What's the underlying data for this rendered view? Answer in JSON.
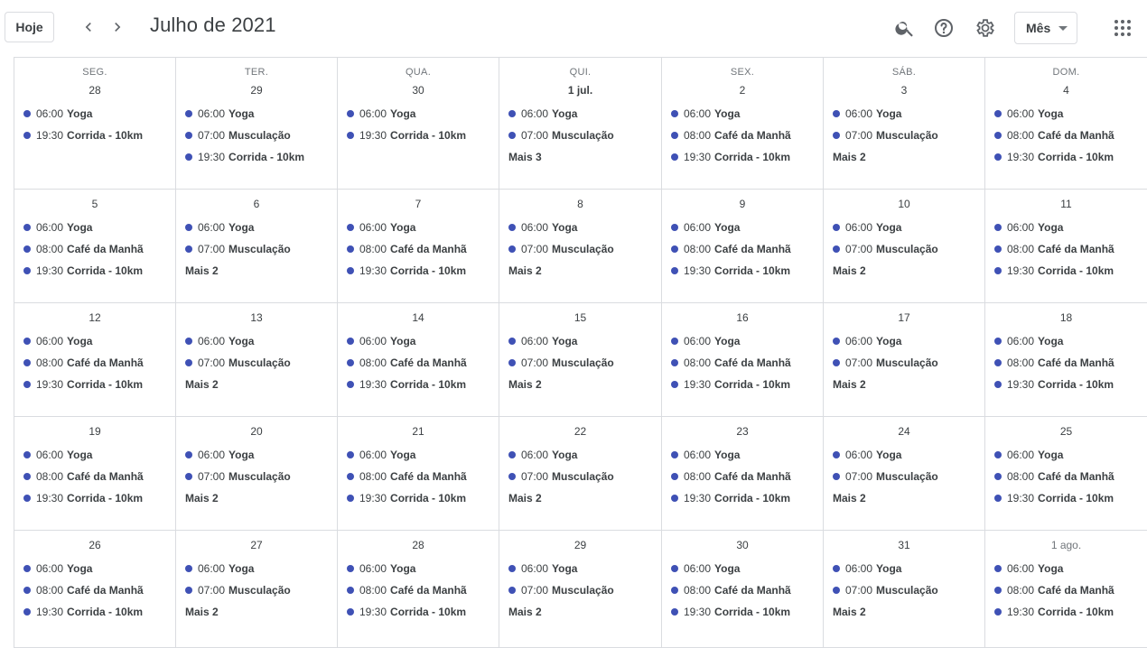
{
  "toolbar": {
    "today_label": "Hoje",
    "title": "Julho de 2021",
    "view_label": "Mês",
    "icons": [
      "chevron-left-icon",
      "chevron-right-icon",
      "search-icon",
      "help-icon",
      "gear-icon",
      "apps-grid-icon"
    ]
  },
  "colors": {
    "event_dot": "#3f51b5",
    "border": "#dadce0"
  },
  "weekdays": [
    "SEG.",
    "TER.",
    "QUA.",
    "QUI.",
    "SEX.",
    "SÁB.",
    "DOM."
  ],
  "weeks": [
    [
      {
        "label": "28",
        "muted": false,
        "events": [
          {
            "time": "06:00",
            "name": "Yoga"
          },
          {
            "time": "19:30",
            "name": "Corrida - 10km"
          }
        ]
      },
      {
        "label": "29",
        "muted": false,
        "events": [
          {
            "time": "06:00",
            "name": "Yoga"
          },
          {
            "time": "07:00",
            "name": "Musculação"
          },
          {
            "time": "19:30",
            "name": "Corrida - 10km"
          }
        ]
      },
      {
        "label": "30",
        "muted": false,
        "events": [
          {
            "time": "06:00",
            "name": "Yoga"
          },
          {
            "time": "19:30",
            "name": "Corrida - 10km"
          }
        ]
      },
      {
        "label": "1 jul.",
        "muted": false,
        "bold": true,
        "events": [
          {
            "time": "06:00",
            "name": "Yoga"
          },
          {
            "time": "07:00",
            "name": "Musculação"
          }
        ],
        "more": "Mais 3"
      },
      {
        "label": "2",
        "muted": false,
        "events": [
          {
            "time": "06:00",
            "name": "Yoga"
          },
          {
            "time": "08:00",
            "name": "Café da Manhã"
          },
          {
            "time": "19:30",
            "name": "Corrida - 10km"
          }
        ]
      },
      {
        "label": "3",
        "muted": false,
        "events": [
          {
            "time": "06:00",
            "name": "Yoga"
          },
          {
            "time": "07:00",
            "name": "Musculação"
          }
        ],
        "more": "Mais 2"
      },
      {
        "label": "4",
        "muted": false,
        "events": [
          {
            "time": "06:00",
            "name": "Yoga"
          },
          {
            "time": "08:00",
            "name": "Café da Manhã"
          },
          {
            "time": "19:30",
            "name": "Corrida - 10km"
          }
        ]
      }
    ],
    [
      {
        "label": "5",
        "events": [
          {
            "time": "06:00",
            "name": "Yoga"
          },
          {
            "time": "08:00",
            "name": "Café da Manhã"
          },
          {
            "time": "19:30",
            "name": "Corrida - 10km"
          }
        ]
      },
      {
        "label": "6",
        "events": [
          {
            "time": "06:00",
            "name": "Yoga"
          },
          {
            "time": "07:00",
            "name": "Musculação"
          }
        ],
        "more": "Mais 2"
      },
      {
        "label": "7",
        "events": [
          {
            "time": "06:00",
            "name": "Yoga"
          },
          {
            "time": "08:00",
            "name": "Café da Manhã"
          },
          {
            "time": "19:30",
            "name": "Corrida - 10km"
          }
        ]
      },
      {
        "label": "8",
        "events": [
          {
            "time": "06:00",
            "name": "Yoga"
          },
          {
            "time": "07:00",
            "name": "Musculação"
          }
        ],
        "more": "Mais 2"
      },
      {
        "label": "9",
        "events": [
          {
            "time": "06:00",
            "name": "Yoga"
          },
          {
            "time": "08:00",
            "name": "Café da Manhã"
          },
          {
            "time": "19:30",
            "name": "Corrida - 10km"
          }
        ]
      },
      {
        "label": "10",
        "events": [
          {
            "time": "06:00",
            "name": "Yoga"
          },
          {
            "time": "07:00",
            "name": "Musculação"
          }
        ],
        "more": "Mais 2"
      },
      {
        "label": "11",
        "events": [
          {
            "time": "06:00",
            "name": "Yoga"
          },
          {
            "time": "08:00",
            "name": "Café da Manhã"
          },
          {
            "time": "19:30",
            "name": "Corrida - 10km"
          }
        ]
      }
    ],
    [
      {
        "label": "12",
        "events": [
          {
            "time": "06:00",
            "name": "Yoga"
          },
          {
            "time": "08:00",
            "name": "Café da Manhã"
          },
          {
            "time": "19:30",
            "name": "Corrida - 10km"
          }
        ]
      },
      {
        "label": "13",
        "events": [
          {
            "time": "06:00",
            "name": "Yoga"
          },
          {
            "time": "07:00",
            "name": "Musculação"
          }
        ],
        "more": "Mais 2"
      },
      {
        "label": "14",
        "events": [
          {
            "time": "06:00",
            "name": "Yoga"
          },
          {
            "time": "08:00",
            "name": "Café da Manhã"
          },
          {
            "time": "19:30",
            "name": "Corrida - 10km"
          }
        ]
      },
      {
        "label": "15",
        "events": [
          {
            "time": "06:00",
            "name": "Yoga"
          },
          {
            "time": "07:00",
            "name": "Musculação"
          }
        ],
        "more": "Mais 2"
      },
      {
        "label": "16",
        "events": [
          {
            "time": "06:00",
            "name": "Yoga"
          },
          {
            "time": "08:00",
            "name": "Café da Manhã"
          },
          {
            "time": "19:30",
            "name": "Corrida - 10km"
          }
        ]
      },
      {
        "label": "17",
        "events": [
          {
            "time": "06:00",
            "name": "Yoga"
          },
          {
            "time": "07:00",
            "name": "Musculação"
          }
        ],
        "more": "Mais 2"
      },
      {
        "label": "18",
        "events": [
          {
            "time": "06:00",
            "name": "Yoga"
          },
          {
            "time": "08:00",
            "name": "Café da Manhã"
          },
          {
            "time": "19:30",
            "name": "Corrida - 10km"
          }
        ]
      }
    ],
    [
      {
        "label": "19",
        "events": [
          {
            "time": "06:00",
            "name": "Yoga"
          },
          {
            "time": "08:00",
            "name": "Café da Manhã"
          },
          {
            "time": "19:30",
            "name": "Corrida - 10km"
          }
        ]
      },
      {
        "label": "20",
        "events": [
          {
            "time": "06:00",
            "name": "Yoga"
          },
          {
            "time": "07:00",
            "name": "Musculação"
          }
        ],
        "more": "Mais 2"
      },
      {
        "label": "21",
        "events": [
          {
            "time": "06:00",
            "name": "Yoga"
          },
          {
            "time": "08:00",
            "name": "Café da Manhã"
          },
          {
            "time": "19:30",
            "name": "Corrida - 10km"
          }
        ]
      },
      {
        "label": "22",
        "events": [
          {
            "time": "06:00",
            "name": "Yoga"
          },
          {
            "time": "07:00",
            "name": "Musculação"
          }
        ],
        "more": "Mais 2"
      },
      {
        "label": "23",
        "events": [
          {
            "time": "06:00",
            "name": "Yoga"
          },
          {
            "time": "08:00",
            "name": "Café da Manhã"
          },
          {
            "time": "19:30",
            "name": "Corrida - 10km"
          }
        ]
      },
      {
        "label": "24",
        "events": [
          {
            "time": "06:00",
            "name": "Yoga"
          },
          {
            "time": "07:00",
            "name": "Musculação"
          }
        ],
        "more": "Mais 2"
      },
      {
        "label": "25",
        "events": [
          {
            "time": "06:00",
            "name": "Yoga"
          },
          {
            "time": "08:00",
            "name": "Café da Manhã"
          },
          {
            "time": "19:30",
            "name": "Corrida - 10km"
          }
        ]
      }
    ],
    [
      {
        "label": "26",
        "events": [
          {
            "time": "06:00",
            "name": "Yoga"
          },
          {
            "time": "08:00",
            "name": "Café da Manhã"
          },
          {
            "time": "19:30",
            "name": "Corrida - 10km"
          }
        ]
      },
      {
        "label": "27",
        "events": [
          {
            "time": "06:00",
            "name": "Yoga"
          },
          {
            "time": "07:00",
            "name": "Musculação"
          }
        ],
        "more": "Mais 2"
      },
      {
        "label": "28",
        "events": [
          {
            "time": "06:00",
            "name": "Yoga"
          },
          {
            "time": "08:00",
            "name": "Café da Manhã"
          },
          {
            "time": "19:30",
            "name": "Corrida - 10km"
          }
        ]
      },
      {
        "label": "29",
        "events": [
          {
            "time": "06:00",
            "name": "Yoga"
          },
          {
            "time": "07:00",
            "name": "Musculação"
          }
        ],
        "more": "Mais 2"
      },
      {
        "label": "30",
        "events": [
          {
            "time": "06:00",
            "name": "Yoga"
          },
          {
            "time": "08:00",
            "name": "Café da Manhã"
          },
          {
            "time": "19:30",
            "name": "Corrida - 10km"
          }
        ]
      },
      {
        "label": "31",
        "events": [
          {
            "time": "06:00",
            "name": "Yoga"
          },
          {
            "time": "07:00",
            "name": "Musculação"
          }
        ],
        "more": "Mais 2"
      },
      {
        "label": "1 ago.",
        "muted": true,
        "events": [
          {
            "time": "06:00",
            "name": "Yoga"
          },
          {
            "time": "08:00",
            "name": "Café da Manhã"
          },
          {
            "time": "19:30",
            "name": "Corrida - 10km"
          }
        ]
      }
    ]
  ]
}
